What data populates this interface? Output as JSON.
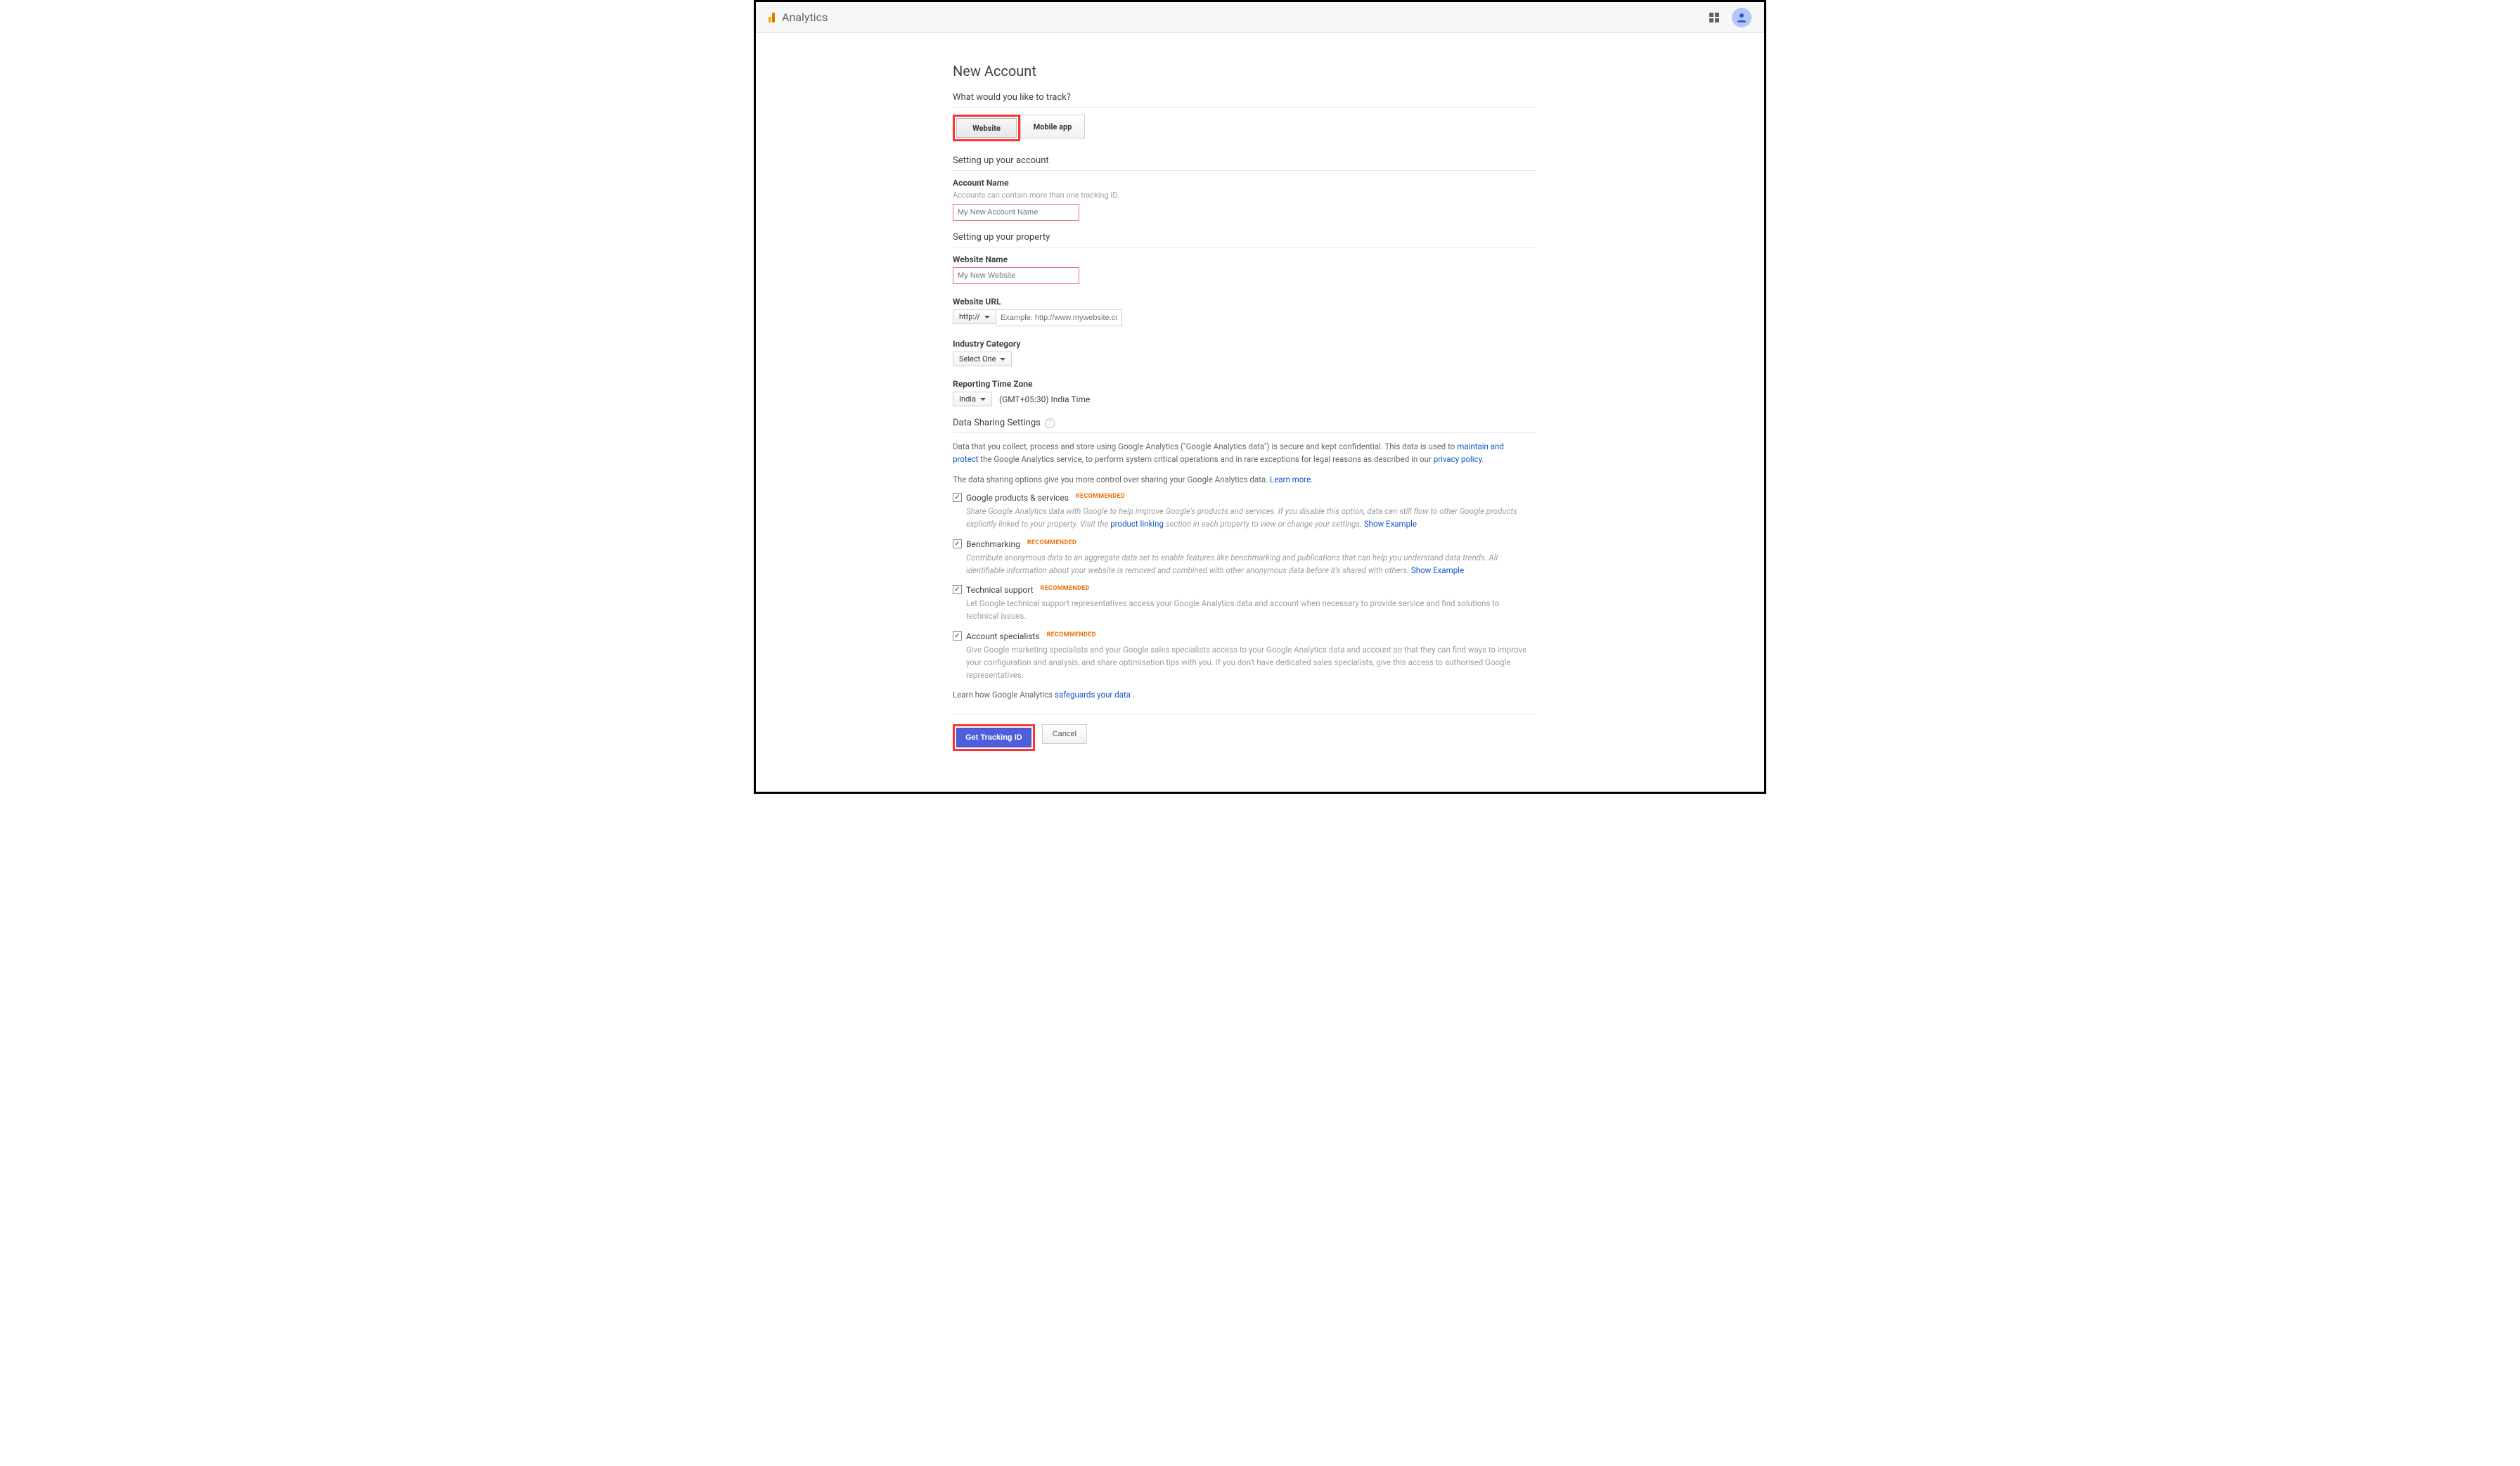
{
  "header": {
    "product_title": "Analytics"
  },
  "page": {
    "title": "New Account",
    "track_question": "What would you like to track?",
    "tab_website": "Website",
    "tab_mobile": "Mobile app",
    "section_account": "Setting up your account",
    "account_name_label": "Account Name",
    "account_name_hint": "Accounts can contain more than one tracking ID.",
    "account_name_placeholder": "My New Account Name",
    "section_property": "Setting up your property",
    "website_name_label": "Website Name",
    "website_name_placeholder": "My New Website",
    "website_url_label": "Website URL",
    "url_scheme": "http://",
    "url_placeholder": "Example: http://www.mywebsite.com",
    "industry_label": "Industry Category",
    "industry_select": "Select One",
    "tz_label": "Reporting Time Zone",
    "tz_country": "India",
    "tz_value": "(GMT+05:30) India Time",
    "section_datasharing": "Data Sharing Settings",
    "ds_p1_a": "Data that you collect, process and store using Google Analytics (\"Google Analytics data\") is secure and kept confidential. This data is used to ",
    "ds_p1_link1": "maintain and protect",
    "ds_p1_b": " the Google Analytics service, to perform system critical operations and in rare exceptions for legal reasons as described in our ",
    "ds_p1_link2": "privacy policy",
    "ds_p1_c": ".",
    "ds_p2_a": "The data sharing options give you more control over sharing your Google Analytics data. ",
    "ds_p2_link": "Learn more.",
    "reco": "RECOMMENDED",
    "chk1_label": "Google products & services",
    "chk1_desc_a": "Share Google Analytics data with Google to help improve Google's products and services. If you disable this option, data can still flow to other Google products explicitly linked to your property. Visit the ",
    "chk1_desc_link1": "product linking",
    "chk1_desc_b": " section in each property to view or change your settings. ",
    "chk1_desc_link2": "Show Example",
    "chk2_label": "Benchmarking",
    "chk2_desc_a": "Contribute anonymous data to an aggregate data set to enable features like benchmarking and publications that can help you understand data trends. All identifiable information about your website is removed and combined with other anonymous data before it's shared with others. ",
    "chk2_desc_link": "Show Example",
    "chk3_label": "Technical support",
    "chk3_desc": "Let Google technical support representatives access your Google Analytics data and account when necessary to provide service and find solutions to technical issues.",
    "chk4_label": "Account specialists",
    "chk4_desc": "Give Google marketing specialists and your Google sales specialists access to your Google Analytics data and account so that they can find ways to improve your configuration and analysis, and share optimisation tips with you. If you don't have dedicated sales specialists, give this access to authorised Google representatives.",
    "safeguard_a": "Learn how Google Analytics ",
    "safeguard_link": "safeguards your data",
    "safeguard_b": " .",
    "btn_primary": "Get Tracking ID",
    "btn_cancel": "Cancel"
  }
}
